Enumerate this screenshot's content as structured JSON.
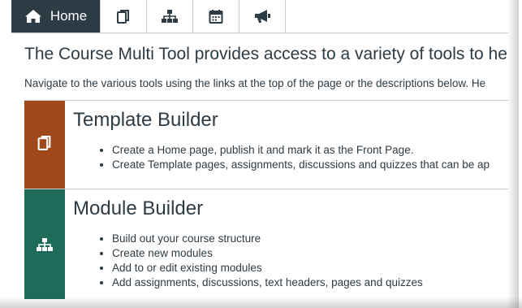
{
  "tabs": {
    "home_label": "Home",
    "icons": [
      "home-icon",
      "copy-icon",
      "sitemap-icon",
      "calendar-icon",
      "bullhorn-icon"
    ]
  },
  "intro": "The Course Multi Tool provides access to a variety of tools to help ra",
  "navigate": "Navigate to the various tools using the links at the top of the page or the descriptions below. He",
  "sections": [
    {
      "title": "Template Builder",
      "color": "#a0481a",
      "icon": "copy-icon",
      "items": [
        "Create a Home page, publish it and mark it as the Front Page.",
        "Create Template pages, assignments, discussions and quizzes that can be ap"
      ]
    },
    {
      "title": "Module Builder",
      "color": "#1e6b5a",
      "icon": "sitemap-icon",
      "items": [
        "Build out your course structure",
        "Create new modules",
        "Add to or edit existing modules",
        "Add assignments, discussions, text headers, pages and quizzes"
      ]
    }
  ],
  "colors": {
    "tab_active_bg": "#2d3b45",
    "text": "#2d3b45",
    "border": "#c7cdd1"
  }
}
